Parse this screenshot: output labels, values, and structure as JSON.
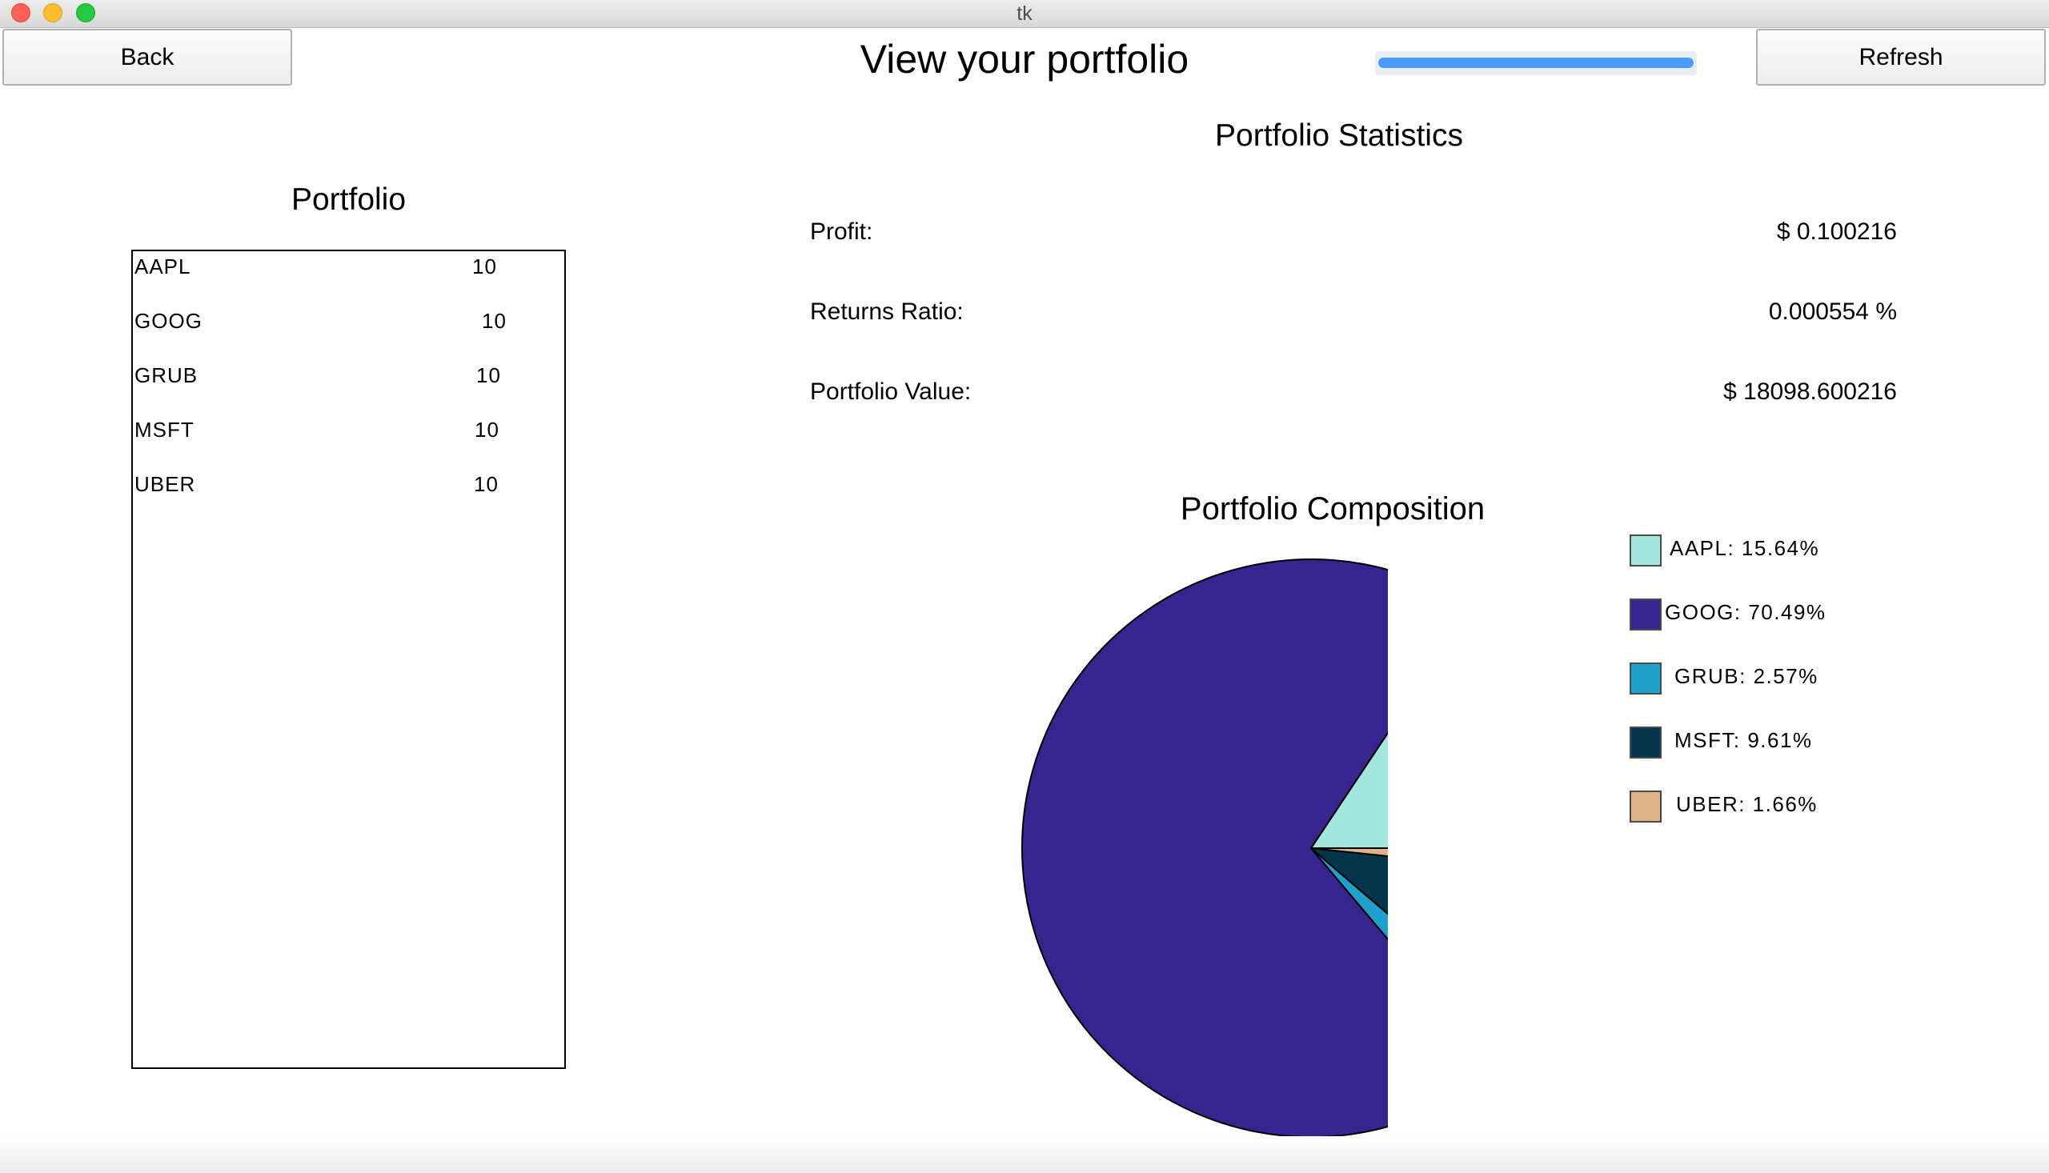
{
  "window": {
    "title": "tk"
  },
  "header": {
    "back_label": "Back",
    "refresh_label": "Refresh",
    "title": "View your portfolio",
    "progress": 1.0
  },
  "portfolio": {
    "heading": "Portfolio",
    "holdings": [
      {
        "symbol": "AAPL",
        "quantity": "10"
      },
      {
        "symbol": "GOOG",
        "quantity": "10"
      },
      {
        "symbol": "GRUB",
        "quantity": "10"
      },
      {
        "symbol": "MSFT",
        "quantity": "10"
      },
      {
        "symbol": "UBER",
        "quantity": "10"
      }
    ]
  },
  "statistics": {
    "heading": "Portfolio Statistics",
    "profit_label": "Profit:",
    "profit_value": "$ 0.100216",
    "returns_label": "Returns Ratio:",
    "returns_value": "0.000554 %",
    "value_label": "Portfolio Value:",
    "value_value": "$ 18098.600216"
  },
  "chart_data": {
    "type": "pie",
    "title": "Portfolio Composition",
    "categories": [
      "AAPL",
      "GOOG",
      "GRUB",
      "MSFT",
      "UBER"
    ],
    "values": [
      15.64,
      70.49,
      2.57,
      9.61,
      1.66
    ],
    "colors": [
      "#a2e6de",
      "#37258f",
      "#21a0cb",
      "#04364b",
      "#deb487"
    ],
    "legend_labels": [
      "AAPL: 15.64%",
      "GOOG: 70.49%",
      "GRUB: 2.57%",
      "MSFT: 9.61%",
      "UBER: 1.66%"
    ],
    "legend_position": "right"
  }
}
